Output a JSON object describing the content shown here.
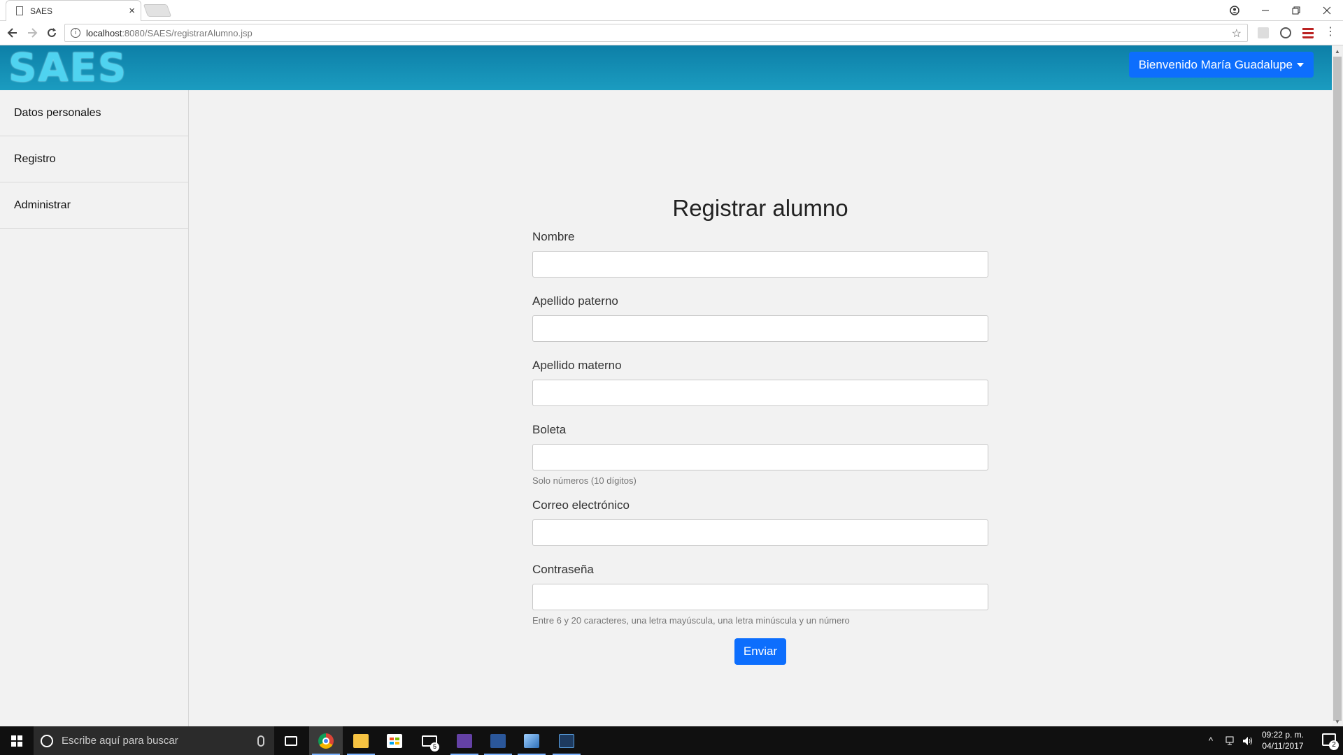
{
  "browser": {
    "tab_title": "SAES",
    "tab_close": "×",
    "url_host": "localhost",
    "url_rest": ":8080/SAES/registrarAlumno.jsp",
    "icons": [
      "document-icon",
      "info-icon",
      "star-icon",
      "back-icon",
      "forward-icon",
      "reload-icon",
      "account-icon",
      "minimize-icon",
      "restore-icon",
      "close-icon"
    ]
  },
  "header": {
    "logo_text": "SAES",
    "user_menu_label": "Bienvenido María Guadalupe",
    "bg_color": "#1b9cc0"
  },
  "sidebar": {
    "items": [
      {
        "label": "Datos personales"
      },
      {
        "label": "Registro"
      },
      {
        "label": "Administrar"
      }
    ]
  },
  "form": {
    "title": "Registrar alumno",
    "fields": [
      {
        "label": "Nombre",
        "value": ""
      },
      {
        "label": "Apellido paterno",
        "value": ""
      },
      {
        "label": "Apellido materno",
        "value": ""
      },
      {
        "label": "Boleta",
        "value": "",
        "help": "Solo números (10 dígitos)"
      },
      {
        "label": "Correo electrónico",
        "value": ""
      },
      {
        "label": "Contraseña",
        "value": "",
        "help": "Entre 6 y 20 caracteres, una letra mayúscula, una letra minúscula y un número"
      }
    ],
    "submit_label": "Enviar",
    "accent_color": "#0d6efd"
  },
  "taskbar": {
    "search_placeholder": "Escribe aquí para buscar",
    "mail_badge": "5",
    "time": "09:22 p. m.",
    "date": "04/11/2017",
    "notification_count": "2"
  }
}
